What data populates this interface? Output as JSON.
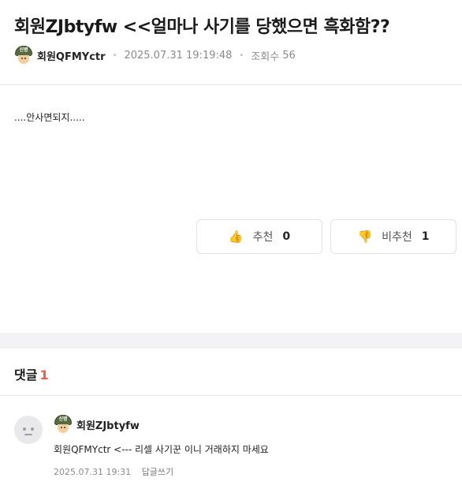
{
  "post": {
    "title": "회원ZJbtyfw <<얼마나 사기를 당했으면 흑화함??",
    "author": "회원QFMYctr",
    "rank_badge": "신병",
    "datetime": "2025.07.31 19:19:48",
    "views_label": "조회수",
    "views": "56",
    "body": "....안사면되지.....",
    "upvote_label": "추천",
    "upvote_count": "0",
    "downvote_label": "비추천",
    "downvote_count": "1",
    "upvote_icon": "thumbs-up-icon",
    "downvote_icon": "thumbs-down-icon"
  },
  "comments": {
    "header_label": "댓글",
    "count": "1",
    "items": [
      {
        "author": "회원ZJbtyfw",
        "rank_badge": "신병",
        "text": "회원QFMYctr <--- 리셀 사기꾼 이니 거래하지 마세요",
        "datetime": "2025.07.31 19:31",
        "reply_label": "답글쓰기"
      }
    ]
  },
  "colors": {
    "accent_count": "#f05a4a",
    "thumb": "#f0a229",
    "helmet": "#556b3f"
  }
}
